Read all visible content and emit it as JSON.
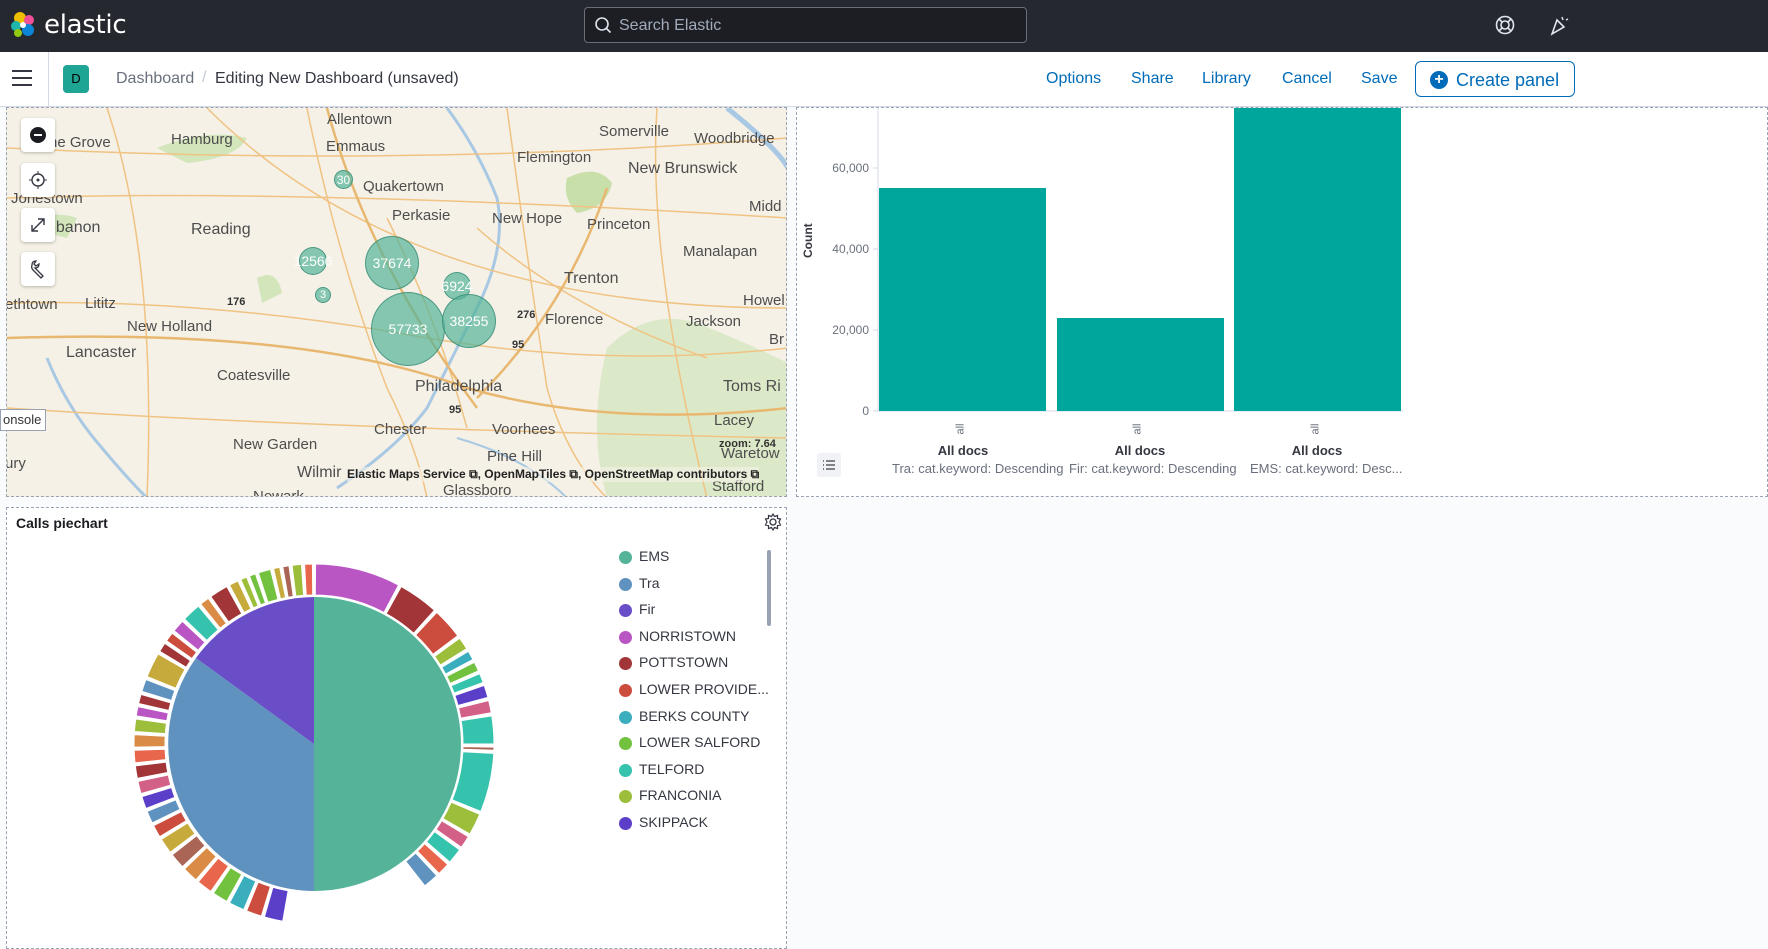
{
  "header": {
    "brand": "elastic",
    "search_placeholder": "Search Elastic"
  },
  "subheader": {
    "avatar_letter": "D",
    "breadcrumb_root": "Dashboard",
    "breadcrumb_current": "Editing New Dashboard (unsaved)",
    "actions": [
      "Options",
      "Share",
      "Library",
      "Cancel",
      "Save"
    ],
    "create_panel": "Create panel"
  },
  "map": {
    "labels": [
      {
        "text": "Allentown"
      },
      {
        "text": "Somerville"
      },
      {
        "text": "Woodbridge"
      },
      {
        "text": "he Grove"
      },
      {
        "text": "Hamburg"
      },
      {
        "text": "Emmaus"
      },
      {
        "text": "Flemington"
      },
      {
        "text": "New Brunswick"
      },
      {
        "text": "Quakertown"
      },
      {
        "text": "Jonestown"
      },
      {
        "text": "Perkasie"
      },
      {
        "text": "New Hope"
      },
      {
        "text": "Princeton"
      },
      {
        "text": "Midd"
      },
      {
        "text": "ebanon"
      },
      {
        "text": "Reading"
      },
      {
        "text": "Manalapan"
      },
      {
        "text": "Trenton"
      },
      {
        "text": "Howel"
      },
      {
        "text": "ethtown"
      },
      {
        "text": "Lititz"
      },
      {
        "text": "Florence"
      },
      {
        "text": "Jackson"
      },
      {
        "text": "New Holland"
      },
      {
        "text": "Br"
      },
      {
        "text": "Lancaster"
      },
      {
        "text": "Philadelphia"
      },
      {
        "text": "Toms Ri"
      },
      {
        "text": "Coatesville"
      },
      {
        "text": "Lacey"
      },
      {
        "text": "Chester"
      },
      {
        "text": "Voorhees"
      },
      {
        "text": "New Garden"
      },
      {
        "text": "Pine Hill"
      },
      {
        "text": "Waretow"
      },
      {
        "text": "ury"
      },
      {
        "text": "Wilmir"
      },
      {
        "text": "Glassboro"
      },
      {
        "text": "Stafford"
      },
      {
        "text": "Newark"
      }
    ],
    "roads": [
      "176",
      "276",
      "95",
      "95"
    ],
    "clusters": [
      "30",
      "12566",
      "37674",
      "3",
      "6924",
      "57733",
      "38255"
    ],
    "attribution": "Elastic Maps Service ⧉, OpenMapTiles ⧉, OpenStreetMap contributors ⧉",
    "zoom": "zoom: 7.64",
    "console_tab": "onsole"
  },
  "bar_chart": {
    "ylabel": "Count",
    "yticks": [
      "60,000",
      "40,000",
      "20,000",
      "0"
    ],
    "x_tick": "all",
    "categories": [
      "All docs",
      "All docs",
      "All docs"
    ],
    "subtitles": [
      "Tra: cat.keyword: Descending",
      "Fir: cat.keyword: Descending",
      "EMS: cat.keyword: Desc..."
    ]
  },
  "chart_data": {
    "type": "bar",
    "categories": [
      "Tra: cat.keyword: Descending",
      "Fir: cat.keyword: Descending",
      "EMS: cat.keyword: Desc..."
    ],
    "values": [
      55000,
      23000,
      75000
    ],
    "ylabel": "Count",
    "ylim": [
      0,
      75000
    ],
    "grid": false
  },
  "pie": {
    "title": "Calls piechart",
    "legend": [
      {
        "label": "EMS",
        "color": "#54b399"
      },
      {
        "label": "Tra",
        "color": "#6092c0"
      },
      {
        "label": "Fir",
        "color": "#6a4ec8"
      },
      {
        "label": "NORRISTOWN",
        "color": "#b956c4"
      },
      {
        "label": "POTTSTOWN",
        "color": "#a23538"
      },
      {
        "label": "LOWER PROVIDE...",
        "color": "#cc4d3d"
      },
      {
        "label": "BERKS COUNTY",
        "color": "#3aaebd"
      },
      {
        "label": "LOWER SALFORD",
        "color": "#72c13f"
      },
      {
        "label": "TELFORD",
        "color": "#35c3ad"
      },
      {
        "label": "FRANCONIA",
        "color": "#9cbe3a"
      },
      {
        "label": "SKIPPACK",
        "color": "#5b3fc9"
      }
    ]
  }
}
